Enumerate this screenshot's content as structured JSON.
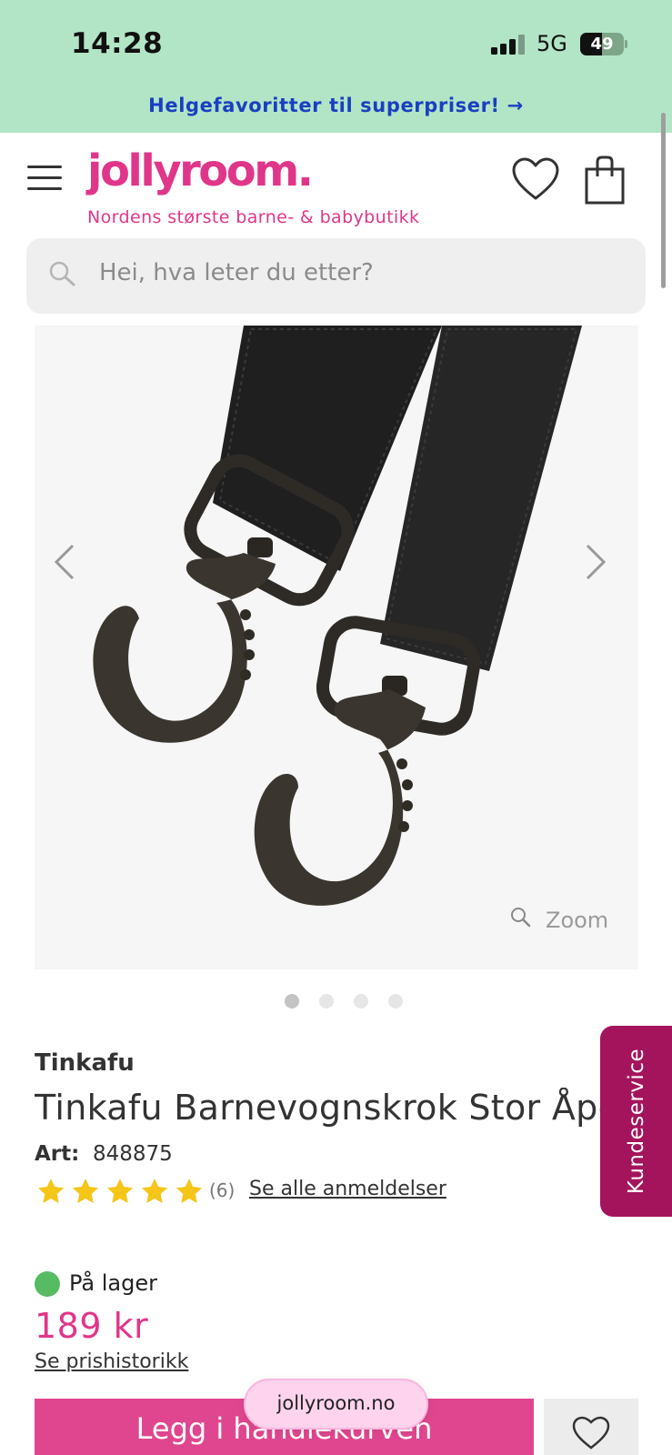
{
  "status_bar": {
    "time": "14:28",
    "network": "5G",
    "battery_text": "49",
    "battery_level": 0.49
  },
  "promo": {
    "text": "Helgefavoritter til superpriser! →"
  },
  "header": {
    "logo": "jollyroom.",
    "tagline": "Nordens største barne- & babybutikk",
    "icons": [
      "menu-icon",
      "heart-icon",
      "shopping-bag-icon"
    ]
  },
  "search": {
    "placeholder": "Hei, hva leter du etter?"
  },
  "gallery": {
    "zoom_label": "Zoom",
    "image_count": 4,
    "active_index": 0
  },
  "product": {
    "brand": "Tinkafu",
    "title": "Tinkafu Barnevognskrok Stor Åpen",
    "art_label": "Art:",
    "art_number": "848875",
    "rating": 5,
    "review_count": "(6)",
    "reviews_link": "Se alle anmeldelser",
    "stock": "På lager",
    "price": "189 kr",
    "price_history": "Se prishistorikk",
    "add_to_cart": "Legg i handlekurven"
  },
  "side_tab": {
    "label": "Kundeservice"
  },
  "browser": {
    "url": "jollyroom.no"
  },
  "colors": {
    "brand_pink": "#e0368a",
    "promo_bg": "#b2e5c6",
    "promo_text": "#1a3fc0",
    "side_tab": "#a4145c",
    "in_stock": "#57bb63",
    "star": "#f5c518"
  }
}
